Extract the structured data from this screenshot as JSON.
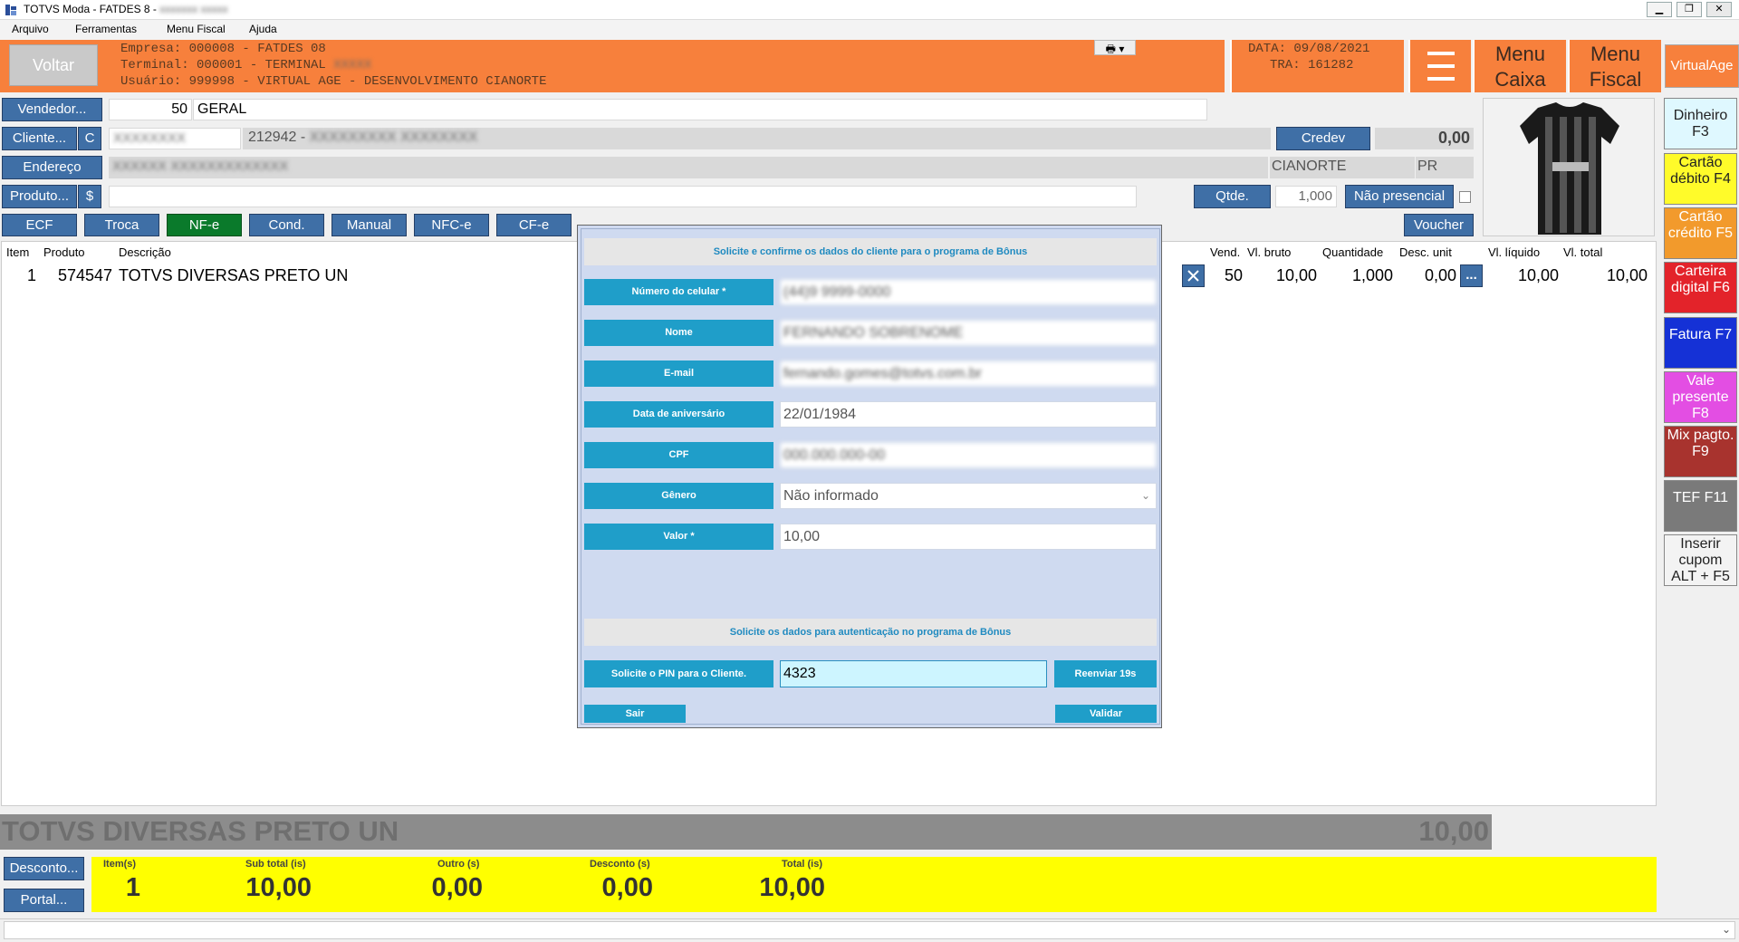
{
  "window": {
    "title": "TOTVS Moda - FATDES 8 - ",
    "title_blurred": "xxxxxxx xxxxx"
  },
  "menubar": {
    "items": [
      "Arquivo",
      "Ferramentas",
      "Menu Fiscal",
      "Ajuda"
    ]
  },
  "header": {
    "back_label": "Voltar",
    "empresa": "Empresa: 000008 - FATDES 08",
    "terminal": "Terminal: 000001 - TERMINAL ",
    "usuario": "Usuário: 999998 - VIRTUAL AGE - DESENVOLVIMENTO CIANORTE",
    "data": "DATA: 09/08/2021",
    "tra": "TRA: 161282",
    "menu_caixa": "Menu Caixa",
    "menu_fiscal": "Menu Fiscal",
    "brand": "VirtualAge",
    "accent": "#f7803c"
  },
  "form": {
    "vendedor_label": "Vendedor...",
    "vendedor_code": "50",
    "vendedor_name": "GERAL",
    "cliente_label": "Cliente...",
    "cliente_c": "C",
    "cliente_code": "212942 - ",
    "credev_label": "Credev",
    "credev_value": "0,00",
    "endereco_label": "Endereço",
    "city": "CIANORTE",
    "uf": "PR",
    "produto_label": "Produto...",
    "produto_dollar": "$",
    "qtde_label": "Qtde.",
    "qtde_value": "1,000",
    "nao_presencial": "Não presencial",
    "voucher": "Voucher"
  },
  "doc_buttons": [
    "ECF",
    "Troca",
    "NF-e",
    "Cond.",
    "Manual",
    "NFC-e",
    "CF-e"
  ],
  "grid": {
    "headers": [
      "Item",
      "Produto",
      "Descrição",
      "Vend.",
      "Vl. bruto",
      "Quantidade",
      "Desc. unit",
      "Vl. líquido",
      "Vl. total"
    ],
    "rows": [
      {
        "item": "1",
        "produto": "574547",
        "descricao": "TOTVS DIVERSAS PRETO UN",
        "vend": "50",
        "vl_bruto": "10,00",
        "quantidade": "1,000",
        "desc_unit": "0,00",
        "vl_liquido": "10,00",
        "vl_total": "10,00"
      }
    ],
    "more_label": "..."
  },
  "payments": [
    {
      "label": "Dinheiro F3",
      "bg": "#dff8ff",
      "fg": "#222"
    },
    {
      "label": "Cartão débito F4",
      "bg": "#fffb2a",
      "fg": "#222"
    },
    {
      "label": "Cartão crédito F5",
      "bg": "#f29a2c",
      "fg": "#fff"
    },
    {
      "label": "Carteira digital F6",
      "bg": "#e3232a",
      "fg": "#fff"
    },
    {
      "label": "Fatura F7",
      "bg": "#1531d6",
      "fg": "#fff"
    },
    {
      "label": "Vale presente F8",
      "bg": "#e34ee3",
      "fg": "#fff"
    },
    {
      "label": "Mix pagto. F9",
      "bg": "#a8332e",
      "fg": "#fff"
    },
    {
      "label": "TEF F11",
      "bg": "#7a7a7a",
      "fg": "#fff"
    },
    {
      "label": "Inserir cupom ALT + F5",
      "bg": "#f3f3f3",
      "fg": "#222"
    }
  ],
  "modal": {
    "header1": "Solicite e confirme os dados do cliente para o programa de Bônus",
    "fields": [
      {
        "label": "Número do celular *",
        "value": "(44)9 9999-0000",
        "blurred": true
      },
      {
        "label": "Nome",
        "value": "FERNANDO SOBRENOME",
        "blurred": true
      },
      {
        "label": "E-mail",
        "value": "fernando.gomes@totvs.com.br",
        "blurred": true
      },
      {
        "label": "Data de aniversário",
        "value": "22/01/1984",
        "blurred": false
      },
      {
        "label": "CPF",
        "value": "000.000.000-00",
        "blurred": true
      },
      {
        "label": "Gênero",
        "value": "Não informado",
        "blurred": false
      },
      {
        "label": "Valor *",
        "value": "10,00",
        "blurred": false
      }
    ],
    "header2": "Solicite os dados para autenticação no programa de Bônus",
    "pin_label": "Solicite o PIN para o Cliente.",
    "pin_value": "4323",
    "resend_label": "Reenviar 19s",
    "exit_label": "Sair",
    "validate_label": "Validar"
  },
  "summary": {
    "description": "TOTVS DIVERSAS PRETO UN",
    "value": "10,00"
  },
  "footer": {
    "desconto_label": "Desconto...",
    "portal_label": "Portal...",
    "totals": [
      {
        "label": "Item(s)",
        "value": "1"
      },
      {
        "label": "Sub total (is)",
        "value": "10,00"
      },
      {
        "label": "Outro (s)",
        "value": "0,00"
      },
      {
        "label": "Desconto (s)",
        "value": "0,00"
      },
      {
        "label": "Total (is)",
        "value": "10,00"
      }
    ]
  }
}
